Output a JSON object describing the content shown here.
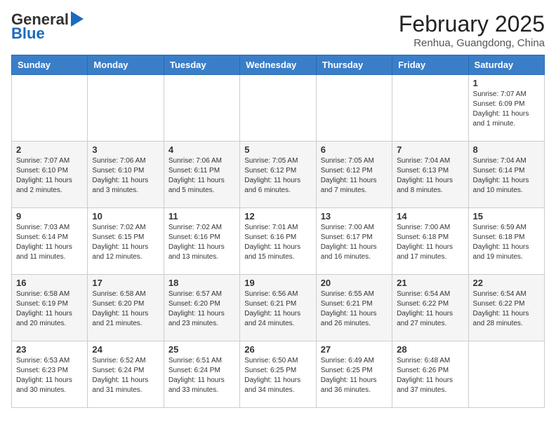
{
  "header": {
    "logo_line1": "General",
    "logo_line2": "Blue",
    "month_title": "February 2025",
    "location": "Renhua, Guangdong, China"
  },
  "days_of_week": [
    "Sunday",
    "Monday",
    "Tuesday",
    "Wednesday",
    "Thursday",
    "Friday",
    "Saturday"
  ],
  "weeks": [
    [
      {
        "day": "",
        "info": ""
      },
      {
        "day": "",
        "info": ""
      },
      {
        "day": "",
        "info": ""
      },
      {
        "day": "",
        "info": ""
      },
      {
        "day": "",
        "info": ""
      },
      {
        "day": "",
        "info": ""
      },
      {
        "day": "1",
        "info": "Sunrise: 7:07 AM\nSunset: 6:09 PM\nDaylight: 11 hours\nand 1 minute."
      }
    ],
    [
      {
        "day": "2",
        "info": "Sunrise: 7:07 AM\nSunset: 6:10 PM\nDaylight: 11 hours\nand 2 minutes."
      },
      {
        "day": "3",
        "info": "Sunrise: 7:06 AM\nSunset: 6:10 PM\nDaylight: 11 hours\nand 3 minutes."
      },
      {
        "day": "4",
        "info": "Sunrise: 7:06 AM\nSunset: 6:11 PM\nDaylight: 11 hours\nand 5 minutes."
      },
      {
        "day": "5",
        "info": "Sunrise: 7:05 AM\nSunset: 6:12 PM\nDaylight: 11 hours\nand 6 minutes."
      },
      {
        "day": "6",
        "info": "Sunrise: 7:05 AM\nSunset: 6:12 PM\nDaylight: 11 hours\nand 7 minutes."
      },
      {
        "day": "7",
        "info": "Sunrise: 7:04 AM\nSunset: 6:13 PM\nDaylight: 11 hours\nand 8 minutes."
      },
      {
        "day": "8",
        "info": "Sunrise: 7:04 AM\nSunset: 6:14 PM\nDaylight: 11 hours\nand 10 minutes."
      }
    ],
    [
      {
        "day": "9",
        "info": "Sunrise: 7:03 AM\nSunset: 6:14 PM\nDaylight: 11 hours\nand 11 minutes."
      },
      {
        "day": "10",
        "info": "Sunrise: 7:02 AM\nSunset: 6:15 PM\nDaylight: 11 hours\nand 12 minutes."
      },
      {
        "day": "11",
        "info": "Sunrise: 7:02 AM\nSunset: 6:16 PM\nDaylight: 11 hours\nand 13 minutes."
      },
      {
        "day": "12",
        "info": "Sunrise: 7:01 AM\nSunset: 6:16 PM\nDaylight: 11 hours\nand 15 minutes."
      },
      {
        "day": "13",
        "info": "Sunrise: 7:00 AM\nSunset: 6:17 PM\nDaylight: 11 hours\nand 16 minutes."
      },
      {
        "day": "14",
        "info": "Sunrise: 7:00 AM\nSunset: 6:18 PM\nDaylight: 11 hours\nand 17 minutes."
      },
      {
        "day": "15",
        "info": "Sunrise: 6:59 AM\nSunset: 6:18 PM\nDaylight: 11 hours\nand 19 minutes."
      }
    ],
    [
      {
        "day": "16",
        "info": "Sunrise: 6:58 AM\nSunset: 6:19 PM\nDaylight: 11 hours\nand 20 minutes."
      },
      {
        "day": "17",
        "info": "Sunrise: 6:58 AM\nSunset: 6:20 PM\nDaylight: 11 hours\nand 21 minutes."
      },
      {
        "day": "18",
        "info": "Sunrise: 6:57 AM\nSunset: 6:20 PM\nDaylight: 11 hours\nand 23 minutes."
      },
      {
        "day": "19",
        "info": "Sunrise: 6:56 AM\nSunset: 6:21 PM\nDaylight: 11 hours\nand 24 minutes."
      },
      {
        "day": "20",
        "info": "Sunrise: 6:55 AM\nSunset: 6:21 PM\nDaylight: 11 hours\nand 26 minutes."
      },
      {
        "day": "21",
        "info": "Sunrise: 6:54 AM\nSunset: 6:22 PM\nDaylight: 11 hours\nand 27 minutes."
      },
      {
        "day": "22",
        "info": "Sunrise: 6:54 AM\nSunset: 6:22 PM\nDaylight: 11 hours\nand 28 minutes."
      }
    ],
    [
      {
        "day": "23",
        "info": "Sunrise: 6:53 AM\nSunset: 6:23 PM\nDaylight: 11 hours\nand 30 minutes."
      },
      {
        "day": "24",
        "info": "Sunrise: 6:52 AM\nSunset: 6:24 PM\nDaylight: 11 hours\nand 31 minutes."
      },
      {
        "day": "25",
        "info": "Sunrise: 6:51 AM\nSunset: 6:24 PM\nDaylight: 11 hours\nand 33 minutes."
      },
      {
        "day": "26",
        "info": "Sunrise: 6:50 AM\nSunset: 6:25 PM\nDaylight: 11 hours\nand 34 minutes."
      },
      {
        "day": "27",
        "info": "Sunrise: 6:49 AM\nSunset: 6:25 PM\nDaylight: 11 hours\nand 36 minutes."
      },
      {
        "day": "28",
        "info": "Sunrise: 6:48 AM\nSunset: 6:26 PM\nDaylight: 11 hours\nand 37 minutes."
      },
      {
        "day": "",
        "info": ""
      }
    ]
  ]
}
